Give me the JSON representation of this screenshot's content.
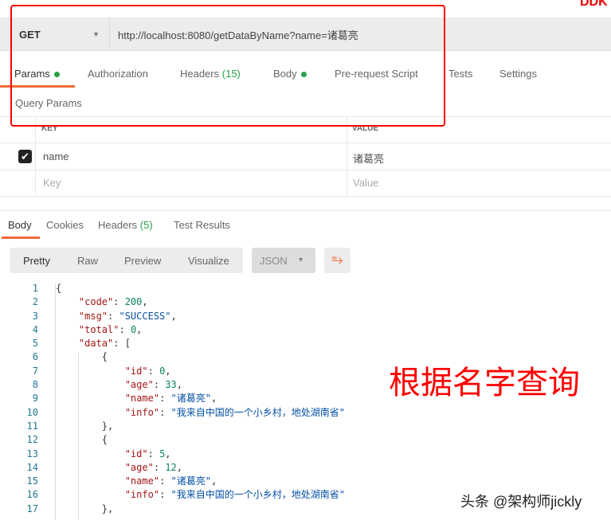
{
  "corner_text": "DDK",
  "request": {
    "method": "GET",
    "url": "http://localhost:8080/getDataByName?name=诸葛亮"
  },
  "req_tabs": {
    "params": "Params",
    "authorization": "Authorization",
    "headers": "Headers",
    "headers_count": "(15)",
    "body": "Body",
    "prerequest": "Pre-request Script",
    "tests": "Tests",
    "settings": "Settings"
  },
  "query_params": {
    "title": "Query Params",
    "key_header": "KEY",
    "value_header": "VALUE",
    "row": {
      "key": "name",
      "value": "诸葛亮",
      "checked": true
    },
    "key_placeholder": "Key",
    "value_placeholder": "Value"
  },
  "resp_tabs": {
    "body": "Body",
    "cookies": "Cookies",
    "headers": "Headers",
    "headers_count": "(5)",
    "test_results": "Test Results"
  },
  "view": {
    "pretty": "Pretty",
    "raw": "Raw",
    "preview": "Preview",
    "visualize": "Visualize",
    "format": "JSON"
  },
  "code_lines": [
    {
      "n": "1",
      "i": 0,
      "t": [
        [
          "p",
          "{"
        ]
      ]
    },
    {
      "n": "2",
      "i": 1,
      "t": [
        [
          "k",
          "\"code\""
        ],
        [
          "p",
          ": "
        ],
        [
          "n",
          "200"
        ],
        [
          "p",
          ","
        ]
      ]
    },
    {
      "n": "3",
      "i": 1,
      "t": [
        [
          "k",
          "\"msg\""
        ],
        [
          "p",
          ": "
        ],
        [
          "s",
          "\"SUCCESS\""
        ],
        [
          "p",
          ","
        ]
      ]
    },
    {
      "n": "4",
      "i": 1,
      "t": [
        [
          "k",
          "\"total\""
        ],
        [
          "p",
          ": "
        ],
        [
          "n",
          "0"
        ],
        [
          "p",
          ","
        ]
      ]
    },
    {
      "n": "5",
      "i": 1,
      "t": [
        [
          "k",
          "\"data\""
        ],
        [
          "p",
          ": ["
        ]
      ]
    },
    {
      "n": "6",
      "i": 2,
      "t": [
        [
          "p",
          "{"
        ]
      ]
    },
    {
      "n": "7",
      "i": 3,
      "t": [
        [
          "k",
          "\"id\""
        ],
        [
          "p",
          ": "
        ],
        [
          "n",
          "0"
        ],
        [
          "p",
          ","
        ]
      ]
    },
    {
      "n": "8",
      "i": 3,
      "t": [
        [
          "k",
          "\"age\""
        ],
        [
          "p",
          ": "
        ],
        [
          "n",
          "33"
        ],
        [
          "p",
          ","
        ]
      ]
    },
    {
      "n": "9",
      "i": 3,
      "t": [
        [
          "k",
          "\"name\""
        ],
        [
          "p",
          ": "
        ],
        [
          "s",
          "\"诸葛亮\""
        ],
        [
          "p",
          ","
        ]
      ]
    },
    {
      "n": "10",
      "i": 3,
      "t": [
        [
          "k",
          "\"info\""
        ],
        [
          "p",
          ": "
        ],
        [
          "s",
          "\"我来自中国的一个小乡村，地处湖南省\""
        ]
      ]
    },
    {
      "n": "11",
      "i": 2,
      "t": [
        [
          "p",
          "},"
        ]
      ]
    },
    {
      "n": "12",
      "i": 2,
      "t": [
        [
          "p",
          "{"
        ]
      ]
    },
    {
      "n": "13",
      "i": 3,
      "t": [
        [
          "k",
          "\"id\""
        ],
        [
          "p",
          ": "
        ],
        [
          "n",
          "5"
        ],
        [
          "p",
          ","
        ]
      ]
    },
    {
      "n": "14",
      "i": 3,
      "t": [
        [
          "k",
          "\"age\""
        ],
        [
          "p",
          ": "
        ],
        [
          "n",
          "12"
        ],
        [
          "p",
          ","
        ]
      ]
    },
    {
      "n": "15",
      "i": 3,
      "t": [
        [
          "k",
          "\"name\""
        ],
        [
          "p",
          ": "
        ],
        [
          "s",
          "\"诸葛亮\""
        ],
        [
          "p",
          ","
        ]
      ]
    },
    {
      "n": "16",
      "i": 3,
      "t": [
        [
          "k",
          "\"info\""
        ],
        [
          "p",
          ": "
        ],
        [
          "s",
          "\"我来自中国的一个小乡村，地处湖南省\""
        ]
      ]
    },
    {
      "n": "17",
      "i": 2,
      "t": [
        [
          "p",
          "},"
        ]
      ]
    }
  ],
  "annotation": "根据名字查询",
  "watermark": "头条 @架构师jickly",
  "colors": {
    "accent": "#f26b3a",
    "green": "#26a047",
    "annotation": "#ff0000"
  }
}
